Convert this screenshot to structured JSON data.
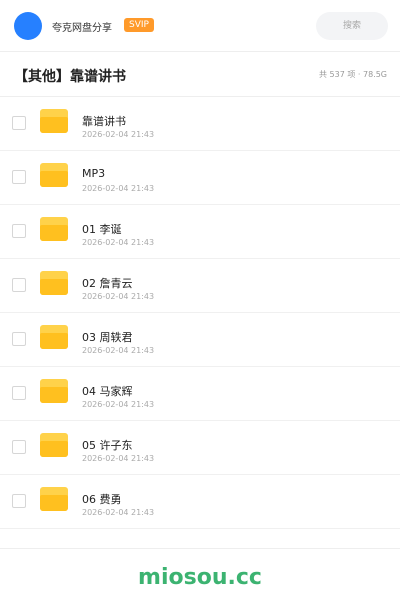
{
  "header": {
    "share_name": "夸克网盘分享",
    "badge": "SVIP",
    "search_placeholder": "搜索"
  },
  "title_bar": {
    "title": "【其他】靠谱讲书",
    "meta": "共 537 项 · 78.5G"
  },
  "files": [
    {
      "name": "靠谱讲书",
      "date": "2026-02-04 21:43"
    },
    {
      "name": "MP3",
      "date": "2026-02-04 21:43"
    },
    {
      "name": "01 李诞",
      "date": "2026-02-04 21:43"
    },
    {
      "name": "02 詹青云",
      "date": "2026-02-04 21:43"
    },
    {
      "name": "03 周轶君",
      "date": "2026-02-04 21:43"
    },
    {
      "name": "04 马家辉",
      "date": "2026-02-04 21:43"
    },
    {
      "name": "05 许子东",
      "date": "2026-02-04 21:43"
    },
    {
      "name": "06 费勇",
      "date": "2026-02-04 21:43"
    }
  ],
  "footer": {
    "watermark": "miosou.cc"
  },
  "colors": {
    "brand_blue": "#2680ff",
    "svip_orange": "#ff9a2a",
    "folder_yellow": "#ffc01f",
    "watermark_green": "#3cb371"
  },
  "icons": {
    "folder": "folder-icon",
    "avatar": "avatar"
  }
}
